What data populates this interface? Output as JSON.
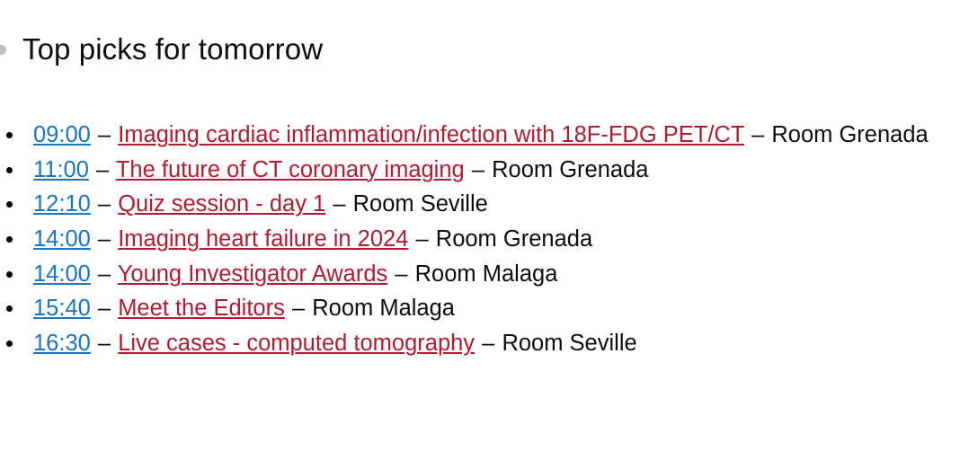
{
  "slide": {
    "heading": "Top picks for tomorrow",
    "heading_bullet_color": "#bfbfbf",
    "background_color": "#ffffff",
    "link_time_color": "#1a75bb",
    "link_title_color": "#ad1d31",
    "text_color": "#0d0d0d",
    "separator": "–"
  },
  "sessions": [
    {
      "time": "09:00",
      "sep1": "–",
      "title": "Imaging cardiac inflammation/infection with 18F-FDG PET/CT",
      "sep2": "–",
      "room": "Room Grenada"
    },
    {
      "time": "11:00",
      "sep1": "–",
      "title": "The future of CT coronary imaging",
      "sep2": "–",
      "room": "Room Grenada"
    },
    {
      "time": "12:10",
      "sep1": "–",
      "title": "Quiz session - day 1",
      "sep2": "–",
      "room": "Room Seville"
    },
    {
      "time": "14:00",
      "sep1": "–",
      "title": "Imaging heart failure in 2024",
      "sep2": "–",
      "room": "Room Grenada"
    },
    {
      "time": "14:00",
      "sep1": "–",
      "title": "Young Investigator Awards",
      "sep2": "–",
      "room": "Room Malaga"
    },
    {
      "time": "15:40",
      "sep1": "–",
      "title": "Meet the Editors",
      "sep2": "–",
      "room": "Room Malaga"
    },
    {
      "time": "16:30",
      "sep1": "–",
      "title": "Live cases - computed tomography",
      "sep2": "–",
      "room": "Room Seville"
    }
  ]
}
